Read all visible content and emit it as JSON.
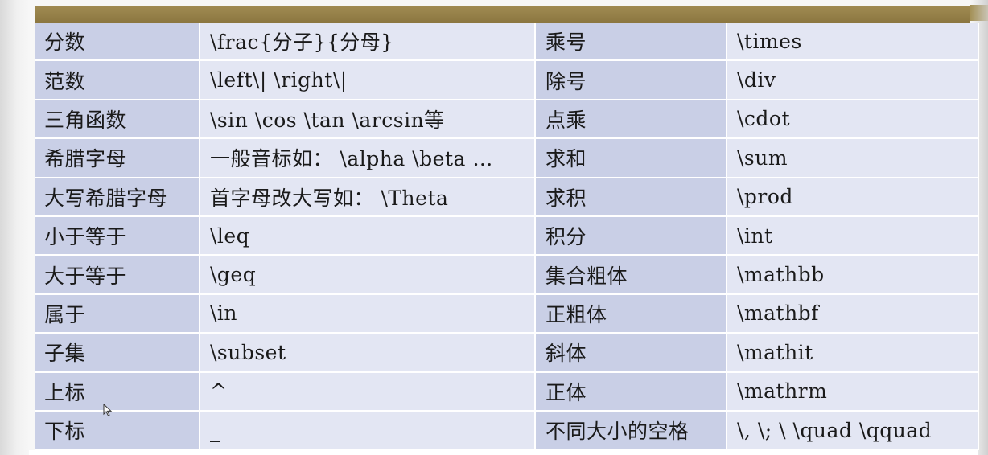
{
  "table": {
    "rows": [
      {
        "name": "分数",
        "code": "\\frac{分子}{分母}",
        "name2": "乘号",
        "code2": "\\times"
      },
      {
        "name": "范数",
        "code": "\\left\\|   \\right\\|",
        "name2": "除号",
        "code2": "\\div"
      },
      {
        "name": "三角函数",
        "code": "\\sin \\cos \\tan \\arcsin等",
        "name2": "点乘",
        "code2": "\\cdot"
      },
      {
        "name": "希腊字母",
        "code": "一般音标如： \\alpha \\beta …",
        "name2": "求和",
        "code2": "\\sum"
      },
      {
        "name": "大写希腊字母",
        "code": "首字母改大写如： \\Theta",
        "name2": "求积",
        "code2": "\\prod"
      },
      {
        "name": "小于等于",
        "code": "\\leq",
        "name2": "积分",
        "code2": "\\int"
      },
      {
        "name": "大于等于",
        "code": "\\geq",
        "name2": "集合粗体",
        "code2": "\\mathbb"
      },
      {
        "name": "属于",
        "code": "\\in",
        "name2": "正粗体",
        "code2": "\\mathbf"
      },
      {
        "name": "子集",
        "code": "\\subset",
        "name2": "斜体",
        "code2": "\\mathit"
      },
      {
        "name": "上标",
        "code": "^",
        "name2": "正体",
        "code2": "\\mathrm"
      },
      {
        "name": "下标",
        "code": "_",
        "name2": "不同大小的空格",
        "code2": "\\, \\; \\  \\quad  \\qquad"
      }
    ]
  },
  "colors": {
    "header_bar": "#8c7740",
    "label_cell": "#c9cfe6",
    "value_cell": "#e3e6f3"
  },
  "icons": {
    "cursor": "mouse-pointer-icon"
  }
}
